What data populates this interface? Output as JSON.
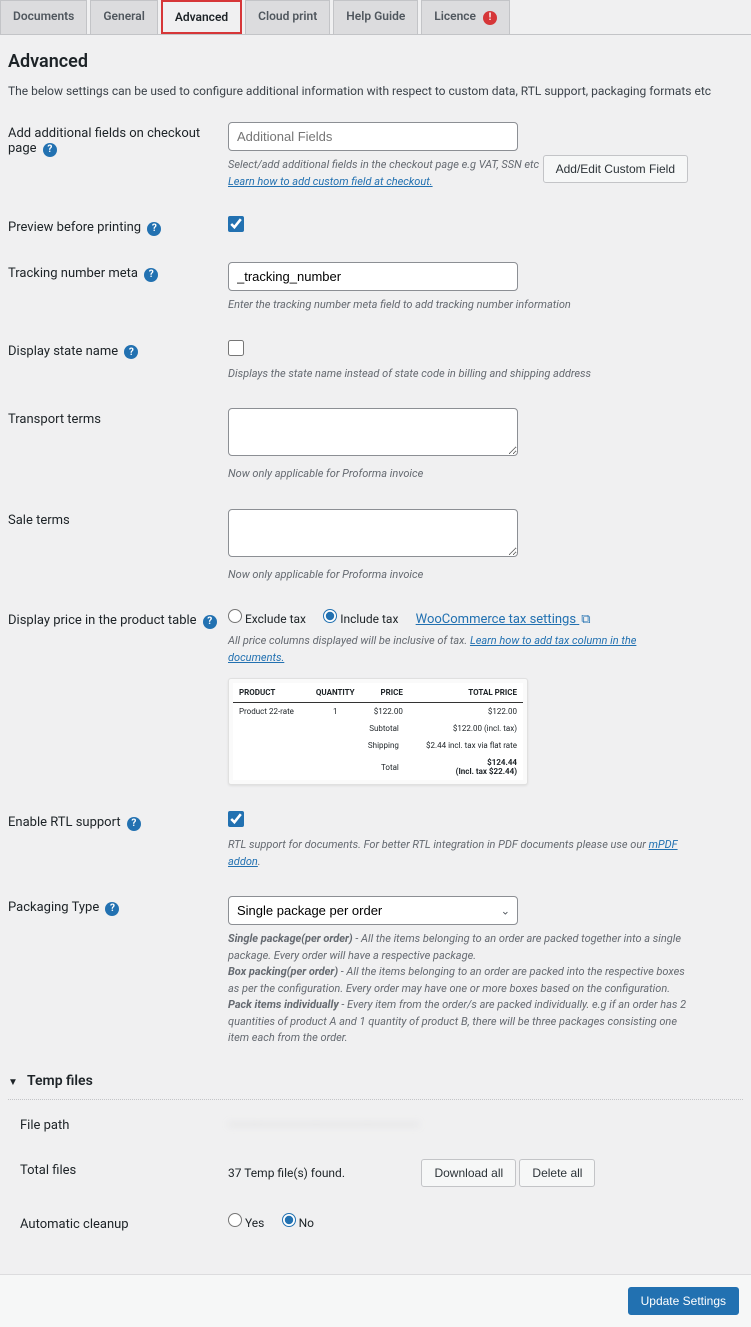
{
  "tabs": [
    "Documents",
    "General",
    "Advanced",
    "Cloud print",
    "Help Guide",
    "Licence"
  ],
  "title": "Advanced",
  "intro": "The below settings can be used to configure additional information with respect to custom data, RTL support, packaging formats etc",
  "fields": {
    "additional": {
      "label": "Add additional fields on checkout page",
      "placeholder": "Additional Fields",
      "desc_prefix": "Select/add additional fields in the checkout page e.g VAT, SSN etc",
      "link": "Learn how to add custom field at checkout.",
      "button": "Add/Edit Custom Field"
    },
    "preview": {
      "label": "Preview before printing"
    },
    "tracking": {
      "label": "Tracking number meta",
      "value": "_tracking_number",
      "desc": "Enter the tracking number meta field to add tracking number information"
    },
    "state": {
      "label": "Display state name",
      "desc": "Displays the state name instead of state code in billing and shipping address"
    },
    "transport": {
      "label": "Transport terms",
      "desc": "Now only applicable for Proforma invoice"
    },
    "sale": {
      "label": "Sale terms",
      "desc": "Now only applicable for Proforma invoice"
    },
    "price": {
      "label": "Display price in the product table",
      "opt_exclude": "Exclude tax",
      "opt_include": "Include tax",
      "settings_link": "WooCommerce tax settings",
      "desc_prefix": "All price columns displayed will be inclusive of tax. ",
      "desc_link": "Learn how to add tax column in the documents."
    },
    "rtl": {
      "label": "Enable RTL support",
      "desc_prefix": "RTL support for documents. For better RTL integration in PDF documents please use our ",
      "desc_link": "mPDF addon",
      "desc_suffix": "."
    },
    "packaging": {
      "label": "Packaging Type",
      "value": "Single package per order",
      "desc1_b": "Single package(per order)",
      "desc1": " - All the items belonging to an order are packed together into a single package. Every order will have a respective package.",
      "desc2_b": "Box packing(per order)",
      "desc2": " - All the items belonging to an order are packed into the respective boxes as per the configuration. Every order may have one or more boxes based on the configuration.",
      "desc3_b": "Pack items individually",
      "desc3": " - Every item from the order/s are packed individually. e.g if an order has 2 quantities of product A and 1 quantity of product B, there will be three packages consisting one item each from the order."
    }
  },
  "temp": {
    "heading": "Temp files",
    "filepath_label": "File path",
    "filepath_value": "……………………………………………………………………",
    "total_label": "Total files",
    "total_value": "37 Temp file(s) found.",
    "download": "Download all",
    "delete": "Delete all",
    "cleanup_label": "Automatic cleanup",
    "yes": "Yes",
    "no": "No"
  },
  "preview_table": {
    "h_product": "PRODUCT",
    "h_qty": "QUANTITY",
    "h_price": "PRICE",
    "h_total": "TOTAL PRICE",
    "row_product": "Product 22-rate",
    "row_qty": "1",
    "row_price": "$122.00",
    "row_total": "$122.00",
    "sub_label": "Subtotal",
    "sub_val": "$122.00 (incl. tax)",
    "ship_label": "Shipping",
    "ship_val": "$2.44 incl. tax via flat rate",
    "tot_label": "Total",
    "tot_val1": "$124.44",
    "tot_val2": "(Incl. tax $22.44)"
  },
  "footer": {
    "update": "Update Settings"
  }
}
